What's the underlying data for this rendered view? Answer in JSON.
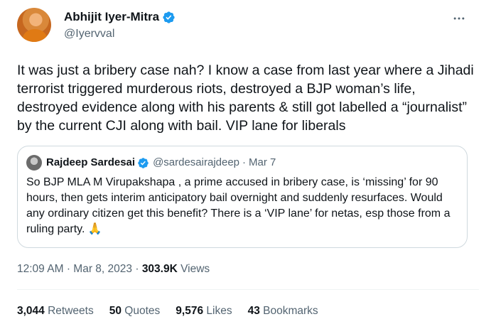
{
  "author": {
    "name": "Abhijit Iyer-Mitra",
    "handle": "@Iyervval"
  },
  "tweet_text": "It was just a bribery case nah? I know a case from last year where a Jihadi terrorist triggered murderous riots, destroyed a BJP woman’s life, destroyed evidence along with his parents & still got labelled a “journalist” by the current CJI along with bail. VIP lane for liberals",
  "quote": {
    "name": "Rajdeep Sardesai",
    "handle": "@sardesairajdeep",
    "separator": "·",
    "date": "Mar 7",
    "text": "So BJP MLA M Virupakshapa , a prime accused in bribery case, is ‘missing’ for 90 hours, then gets interim anticipatory bail overnight and suddenly resurfaces. Would any ordinary citizen get this benefit? There is a ‘VIP lane’ for netas, esp those from a ruling party. 🙏"
  },
  "meta": {
    "time": "12:09 AM",
    "separator": "·",
    "date": "Mar 8, 2023",
    "views_count": "303.9K",
    "views_label": "Views"
  },
  "stats": {
    "retweets_count": "3,044",
    "retweets_label": "Retweets",
    "quotes_count": "50",
    "quotes_label": "Quotes",
    "likes_count": "9,576",
    "likes_label": "Likes",
    "bookmarks_count": "43",
    "bookmarks_label": "Bookmarks"
  },
  "colors": {
    "verified": "#1d9bf0",
    "secondary_text": "#536471",
    "border": "#cfd9de"
  },
  "icons": {
    "verified": "verified-badge-icon",
    "more": "more-horizontal-icon"
  }
}
